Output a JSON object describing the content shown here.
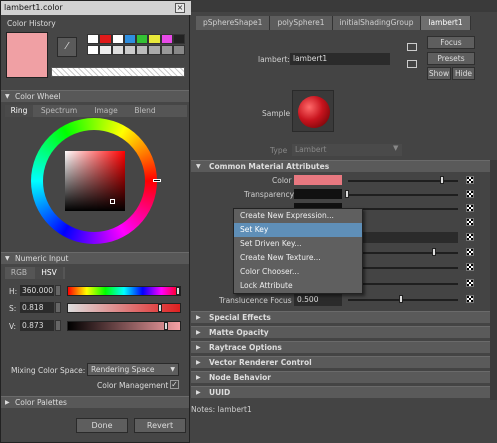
{
  "attribute_editor": {
    "tabs": [
      "pSphereShape1",
      "polySphere1",
      "initialShadingGroup",
      "lambert1"
    ],
    "active_tab": "lambert1",
    "buttons": {
      "focus": "Focus",
      "presets": "Presets",
      "show": "Show",
      "hide": "Hide"
    },
    "node_label": "lambert:",
    "node_name": "lambert1",
    "sample_label": "Sample",
    "type_label": "Type",
    "type_value": "Lambert",
    "common_section": "Common Material Attributes",
    "attributes": [
      {
        "label": "Color",
        "value": ""
      },
      {
        "label": "Transparency",
        "value": ""
      },
      {
        "label": "Translucence Focus",
        "value": "0.500"
      }
    ],
    "sections": [
      "Special Effects",
      "Matte Opacity",
      "Raytrace Options",
      "Vector Renderer Control",
      "Node Behavior",
      "UUID"
    ],
    "notes": "Notes:  lambert1",
    "colors": {
      "material_color": "#e87880",
      "transparency": "#111111",
      "sample_ball": "#c8141e"
    }
  },
  "context_menu": {
    "items": [
      "Create New Expression...",
      "Set Key",
      "Set Driven Key...",
      "Create New Texture...",
      "Color Chooser...",
      "Lock Attribute"
    ],
    "highlighted": "Set Key"
  },
  "color_editor": {
    "title": "lambert1.color",
    "close": "×",
    "history_section": "Color History",
    "swatch_color": "#f0a0a4",
    "history_colors_row1": [
      "#ffffff",
      "#e01a1a",
      "#ffffff",
      "#2f8fe0",
      "#34c234",
      "#e8e83a",
      "#e84ae8",
      "#222222"
    ],
    "history_colors_row2": [
      "#ffffff",
      "#eeeeee",
      "#dddddd",
      "#cccccc",
      "#bbbbbb",
      "#aaaaaa",
      "#999999",
      "#888888"
    ],
    "wheel_section": "Color Wheel",
    "wheel_tabs": [
      "Ring",
      "Spectrum",
      "Image",
      "Blend"
    ],
    "active_wheel_tab": "Ring",
    "numeric_section": "Numeric Input",
    "numeric_tabs": [
      "RGB",
      "HSV"
    ],
    "active_numeric_tab": "HSV",
    "hsv": [
      {
        "label": "H:",
        "value": "360.000",
        "fraction": 1.0
      },
      {
        "label": "S:",
        "value": "0.818",
        "fraction": 0.818
      },
      {
        "label": "V:",
        "value": "0.873",
        "fraction": 0.873
      }
    ],
    "mixing_label": "Mixing Color Space:",
    "mixing_value": "Rendering Space",
    "management_label": "Color Management",
    "management_checked": "✓",
    "palettes_section": "Color Palettes",
    "done": "Done",
    "revert": "Revert"
  }
}
